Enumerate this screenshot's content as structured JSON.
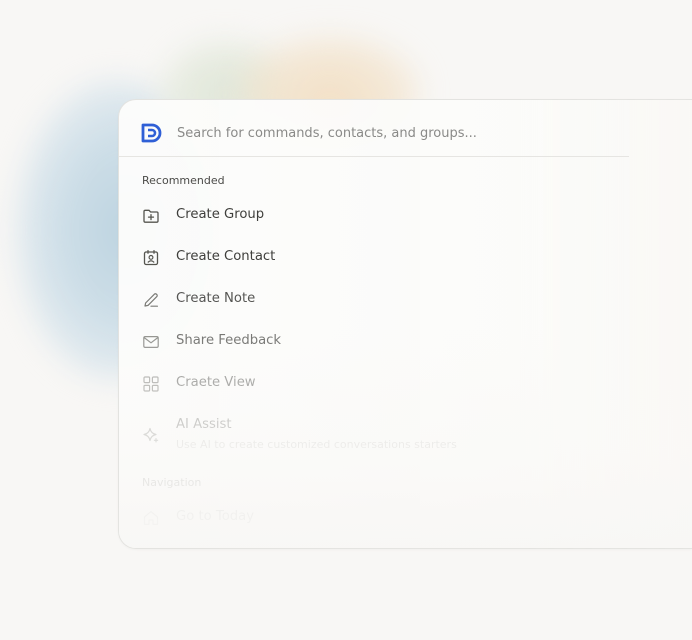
{
  "search": {
    "placeholder": "Search for commands, contacts, and groups..."
  },
  "colors": {
    "accent": "#2f5fd6",
    "background": "#f8f7f5"
  },
  "sections": {
    "recommended": "Recommended",
    "navigation": "Navigation"
  },
  "items": [
    {
      "label": "Create Group",
      "icon": "folder-plus-icon",
      "fade": 1.0
    },
    {
      "label": "Create Contact",
      "icon": "contact-card-icon",
      "fade": 1.0
    },
    {
      "label": "Create Note",
      "icon": "pencil-icon",
      "fade": 0.85
    },
    {
      "label": "Share Feedback",
      "icon": "mail-icon",
      "fade": 0.7
    },
    {
      "label": "Craete View",
      "icon": "grid-icon",
      "fade": 0.55
    },
    {
      "label": "AI Assist",
      "sub": "Use AI to create customized conversations starters",
      "icon": "sparkle-icon",
      "fade": 0.4
    },
    {
      "label": "Go to Today",
      "icon": "home-icon",
      "fade": 0.22
    }
  ]
}
